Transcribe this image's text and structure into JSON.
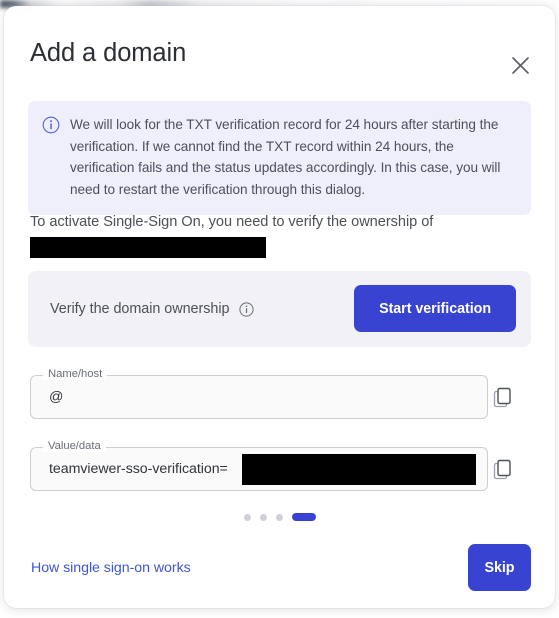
{
  "colors": {
    "accent": "#3943d2",
    "link": "#3f56d6",
    "banner_bg": "#eeeffa",
    "panel_bg": "#f2f2f6",
    "field_bg": "#fafafb",
    "field_border": "#cdced4",
    "text": "#4c5059",
    "title": "#2b2e36",
    "redaction": "#000000"
  },
  "dialog": {
    "title": "Add a domain",
    "close_icon": "close-icon"
  },
  "banner": {
    "icon": "info-circle-icon",
    "text": "We will look for the TXT verification record for 24 hours after starting the verification. If we cannot find the TXT record within 24 hours, the verification fails and the status updates accordingly. In this case, you will need to restart the verification through this dialog."
  },
  "activate": {
    "text": "To activate Single-Sign On, you need to verify the ownership of",
    "domain_value": "",
    "domain_redacted": true
  },
  "verify_panel": {
    "label": "Verify the domain ownership",
    "info_icon": "info-circle-icon",
    "button_label": "Start verification"
  },
  "fields": [
    {
      "label": "Name/host",
      "value": "@",
      "placeholder": "",
      "redacted": false,
      "copy_icon": "copy-icon"
    },
    {
      "label": "Value/data",
      "value": "teamviewer-sso-verification=",
      "placeholder": "",
      "redacted": true,
      "copy_icon": "copy-icon"
    }
  ],
  "stepper": {
    "total": 4,
    "active_index": 3,
    "dots": [
      "step-1",
      "step-2",
      "step-3",
      "step-4"
    ]
  },
  "footer": {
    "link_label": "How single sign-on works",
    "skip_label": "Skip"
  }
}
